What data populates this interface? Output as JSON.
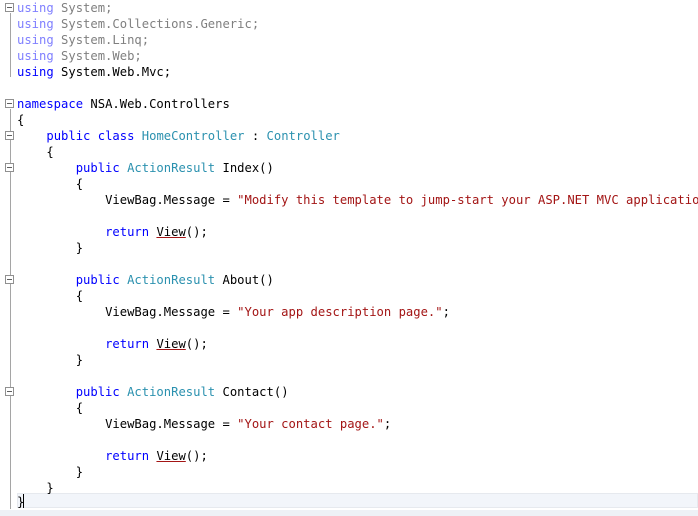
{
  "colors": {
    "keyword": "#0000ff",
    "type": "#2b91af",
    "string": "#a31515",
    "text": "#000000",
    "dim_keyword": "#7f7fff",
    "dim_text": "#7f7f7f"
  },
  "lines": {
    "l1": {
      "kw": "using",
      "name": "System",
      "semi": ";"
    },
    "l2": {
      "kw": "using",
      "name": "System.Collections.Generic",
      "semi": ";"
    },
    "l3": {
      "kw": "using",
      "name": "System.Linq",
      "semi": ";"
    },
    "l4": {
      "kw": "using",
      "name": "System.Web",
      "semi": ";"
    },
    "l5": {
      "kw": "using",
      "name": "System.Web.Mvc",
      "semi": ";"
    },
    "l7": {
      "kw": "namespace",
      "name": "NSA.Web.Controllers"
    },
    "l8": {
      "text": "{"
    },
    "l9": {
      "kw1": "public",
      "kw2": "class",
      "name": "HomeController",
      "colon": " : ",
      "base": "Controller"
    },
    "l10": {
      "text": "{"
    },
    "l11": {
      "kw": "public",
      "type": "ActionResult",
      "name": "Index",
      "parens": "()"
    },
    "l12": {
      "text": "{"
    },
    "l13": {
      "obj": "ViewBag.Message",
      "eq": " = ",
      "str": "\"Modify this template to jump-start your ASP.NET MVC application.\"",
      "semi": ";"
    },
    "l15": {
      "kw": "return",
      "call": "View",
      "rest": "();"
    },
    "l16": {
      "text": "}"
    },
    "l18": {
      "kw": "public",
      "type": "ActionResult",
      "name": "About",
      "parens": "()"
    },
    "l19": {
      "text": "{"
    },
    "l20": {
      "obj": "ViewBag.Message",
      "eq": " = ",
      "str": "\"Your app description page.\"",
      "semi": ";"
    },
    "l22": {
      "kw": "return",
      "call": "View",
      "rest": "();"
    },
    "l23": {
      "text": "}"
    },
    "l25": {
      "kw": "public",
      "type": "ActionResult",
      "name": "Contact",
      "parens": "()"
    },
    "l26": {
      "text": "{"
    },
    "l27": {
      "obj": "ViewBag.Message",
      "eq": " = ",
      "str": "\"Your contact page.\"",
      "semi": ";"
    },
    "l29": {
      "kw": "return",
      "call": "View",
      "rest": "();"
    },
    "l30": {
      "text": "}"
    },
    "l31": {
      "text": "}"
    },
    "l32": {
      "text": "}"
    }
  }
}
